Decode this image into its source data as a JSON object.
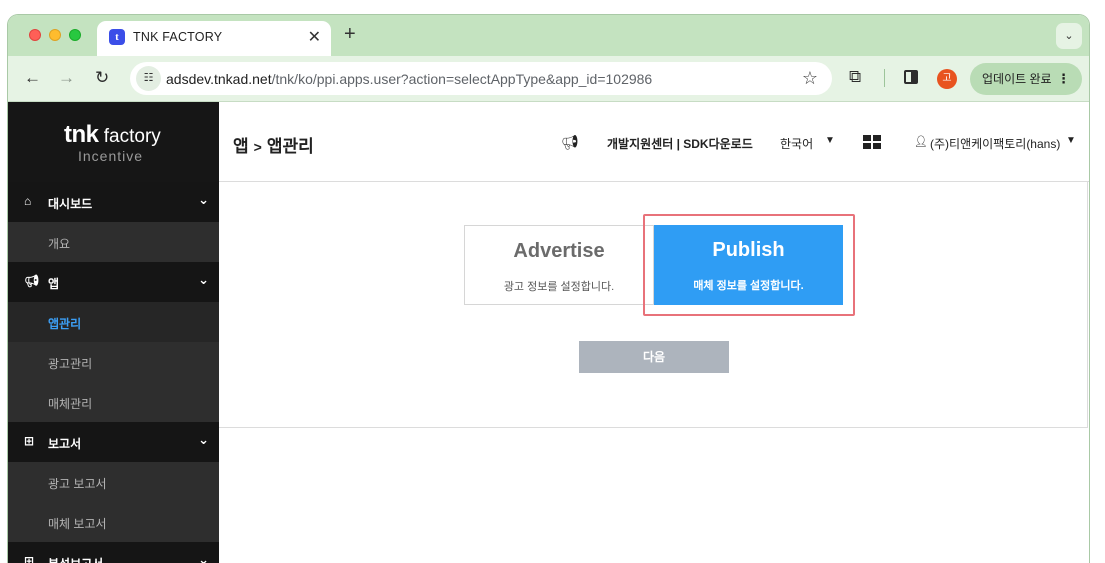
{
  "browser": {
    "tab_favicon": "t",
    "tab_title": "TNK FACTORY",
    "tab_close": "✕",
    "new_tab": "+",
    "tab_dropdown": "⌄",
    "url_host": "adsdev.tnkad.net",
    "url_path": "/tnk/ko/ppi.apps.user?action=selectAppType&app_id=102986",
    "profile_initial": "고",
    "update_label": "업데이트 완료",
    "update_menu": "⋮"
  },
  "sidebar": {
    "logo_main_bold": "tnk",
    "logo_main_rest": " factory",
    "logo_sub": "Incentive",
    "sections": {
      "dashboard": {
        "label": "대시보드",
        "items": [
          "개요"
        ]
      },
      "app": {
        "label": "앱",
        "items": [
          "앱관리",
          "광고관리",
          "매체관리"
        ]
      },
      "report": {
        "label": "보고서",
        "items": [
          "광고 보고서",
          "매체 보고서"
        ]
      },
      "analysis": {
        "label": "분석보고서"
      }
    }
  },
  "header": {
    "breadcrumb_root": "앱",
    "breadcrumb_sep": ">",
    "breadcrumb_current": "앱관리",
    "dev_link": "개발지원센터 | SDK다운로드",
    "language": "한국어",
    "user": "(주)티앤케이팩토리(hans)"
  },
  "main": {
    "advertise": {
      "title": "Advertise",
      "subtitle": "광고 정보를 설정합니다."
    },
    "publish": {
      "title": "Publish",
      "subtitle": "매체 정보를 설정합니다.",
      "selected": true
    },
    "next_label": "다음"
  },
  "colors": {
    "accent": "#2f9df4",
    "sidebar_bg": "#1b1b1b",
    "active_menu": "#3c9ff5",
    "highlight": "#e8727a",
    "disabled_button": "#adb4bd"
  }
}
